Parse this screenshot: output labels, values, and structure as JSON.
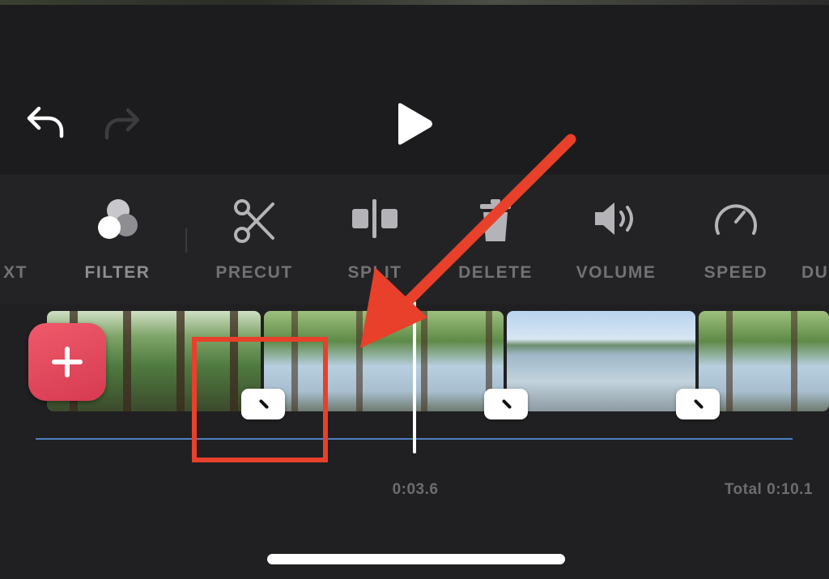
{
  "colors": {
    "accent_red": "#e8402a",
    "add_button": "#e54a5e",
    "audio_line": "#4f7fc0",
    "label_gray": "#727275"
  },
  "toolbar": {
    "undo_icon": "undo-arrow-icon",
    "redo_icon": "redo-arrow-icon",
    "play_icon": "play-icon"
  },
  "tools": [
    {
      "id": "text",
      "label": "XT",
      "icon": "text-icon"
    },
    {
      "id": "filter",
      "label": "FILTER",
      "icon": "filter-circles-icon"
    },
    {
      "id": "precut",
      "label": "PRECUT",
      "icon": "scissors-icon"
    },
    {
      "id": "split",
      "label": "SPLIT",
      "icon": "split-icon"
    },
    {
      "id": "delete",
      "label": "DELETE",
      "icon": "trash-icon"
    },
    {
      "id": "volume",
      "label": "VOLUME",
      "icon": "speaker-icon"
    },
    {
      "id": "speed",
      "label": "SPEED",
      "icon": "speedometer-icon"
    },
    {
      "id": "duration",
      "label": "DU",
      "icon": "duration-icon"
    }
  ],
  "timeline": {
    "current_time": "0:03.6",
    "total_time": "Total 0:10.1",
    "add_button_icon": "plus-icon",
    "transition_icon": "transition-slash-icon"
  }
}
